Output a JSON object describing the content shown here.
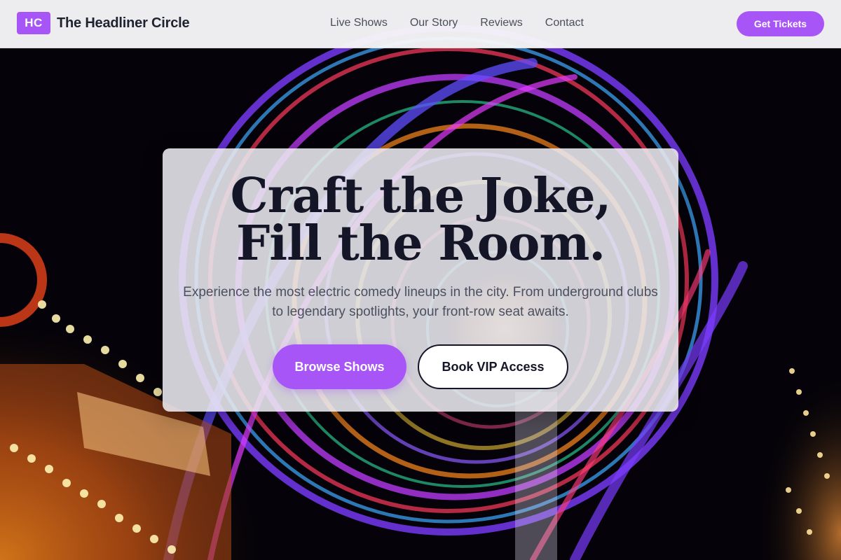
{
  "brand": {
    "mark": "HC",
    "name": "The Headliner Circle"
  },
  "nav": {
    "items": [
      {
        "label": "Live Shows"
      },
      {
        "label": "Our Story"
      },
      {
        "label": "Reviews"
      },
      {
        "label": "Contact"
      }
    ],
    "cta_label": "Get Tickets"
  },
  "hero": {
    "headline_line1": "Craft the Joke,",
    "headline_line2": "Fill the Room.",
    "lede": "Experience the most electric comedy lineups in the city. From underground clubs to legendary spotlights, your front-row seat awaits.",
    "primary_label": "Browse Shows",
    "secondary_label": "Book VIP Access"
  },
  "colors": {
    "accent": "#a855f7",
    "ink": "#141628",
    "nav_bg": "#f7f6f9"
  },
  "background_image": {
    "subject": "long-exposure carnival ride lights at night"
  }
}
